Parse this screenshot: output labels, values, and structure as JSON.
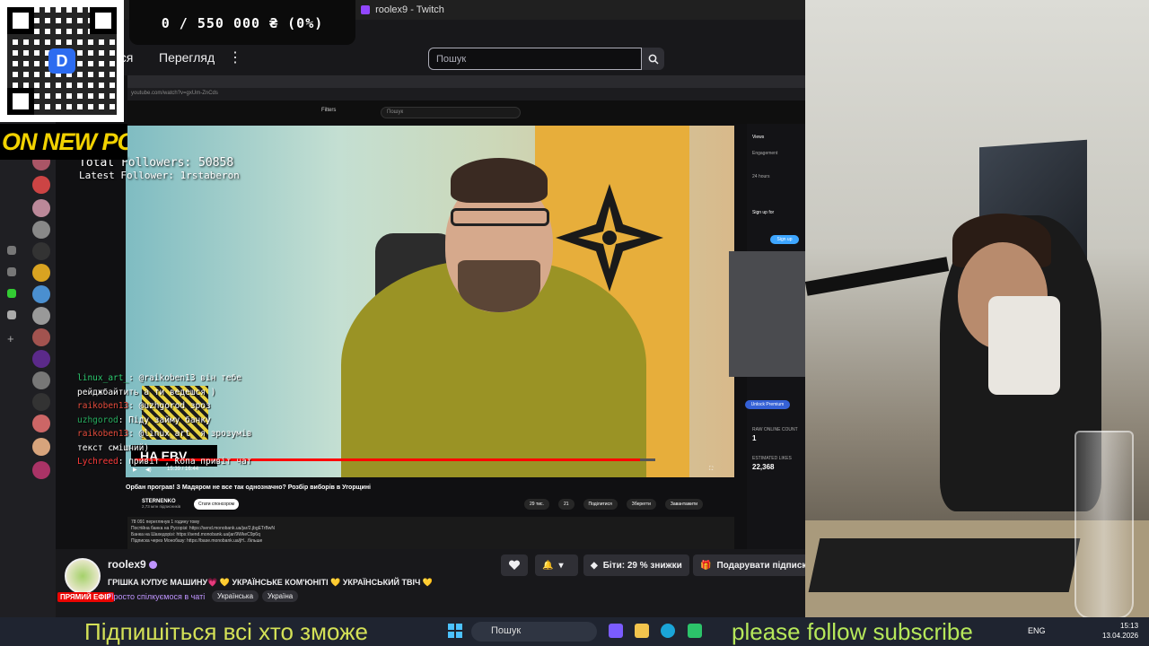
{
  "window": {
    "title": "roolex9 - Twitch"
  },
  "topnav": {
    "following_label": "ться",
    "browse_label": "Перегляд",
    "search_placeholder": "Пошук"
  },
  "overlay": {
    "donation_goal": "0 / 550 000 ₴ (0%)",
    "banner": "ON NEW PC",
    "qr_logo_letter": "D"
  },
  "video": {
    "url": "youtube.com/watch?v=gxUm-ZnCds",
    "yt_search_placeholder": "Пошук",
    "filters_label": "Filters",
    "total_followers": "Total Followers: 50858",
    "latest_follower": "Latest Follower: 1rstaberon",
    "promo_text": "HA EBV",
    "progress_fraction": 0.97,
    "time": "15:39 / 16:44",
    "title": "Орбан програв! З Мадяром не все так однозначно? Розбір виборів в Угорщині",
    "channel": "STERNENKO",
    "subscribers": "2,73 млн підписників",
    "sponsor_label": "Стати спонсором",
    "actions": [
      "29 тис.",
      "21",
      "Поділитися",
      "Зберегти",
      "Завантажити"
    ],
    "desc_lines": [
      "78 091 переглянув 1 годину тому",
      "Постійна банка на Русорізі: https://send.monobank.ua/jar/2.jbgETrBwN",
      "Банка на Шахедорізі: https://send.monobank.ua/jar/9WkeC9p6q",
      "Підписка через Монобазу: https://base.monobank.ua/jH...більше"
    ],
    "right_panel": {
      "views_tab": "Views",
      "engagement": "Engagement",
      "hours": "24 hours",
      "signup_text": "Sign up for",
      "signup_btn": "Sign up",
      "unlock_btn": "Unlock Premium",
      "online_count_label": "RAW ONLINE COUNT",
      "online_count": "1",
      "est_likes_label": "ESTIMATED LIKES",
      "est_likes": "22,368"
    }
  },
  "chat": [
    {
      "user": "linux_art_",
      "text": ": @raikoben13 він тебе рейджбайтить",
      "suffix": " а ти ведешся )"
    },
    {
      "user": "raikoben13",
      "text": ": @uzhgorod зроз",
      "suffix": ""
    },
    {
      "user": "uzhgorod",
      "text": ": Піду займу банку",
      "suffix": ""
    },
    {
      "user": "raikoben13",
      "text": ": @linux_art_ я зрозумів текст смішний)",
      "suffix": ""
    },
    {
      "user": "Lychreed",
      "text": ": привіт , Копа привіт чат",
      "suffix": ""
    }
  ],
  "channel": {
    "name": "roolex9",
    "live_label": "ПРЯМИЙ ЕФІР",
    "title": "ГРІШКА КУПУЄ МАШИНУ💗 💛 УКРАЇНСЬКЕ КОМ'ЮНІТІ 💛 УКРАЇНСЬКИЙ ТВІЧ 💛",
    "category": "Просто спілкуємося в чаті",
    "tags": [
      "Українська",
      "Україна"
    ],
    "bits_label": "Біти: 29 % знижки",
    "gift_label": "Подарувати підписку"
  },
  "tickers": {
    "left": "Підпишіться всі хто зможе",
    "right": "please follow subscribe"
  },
  "taskbar": {
    "search_placeholder": "Пошук",
    "lang": "ENG",
    "time": "15:13",
    "date": "13.04.2026"
  },
  "colors": {
    "twitch_purple": "#9146ff",
    "live_red": "#eb0400",
    "ticker_green": "#b6e85a"
  }
}
